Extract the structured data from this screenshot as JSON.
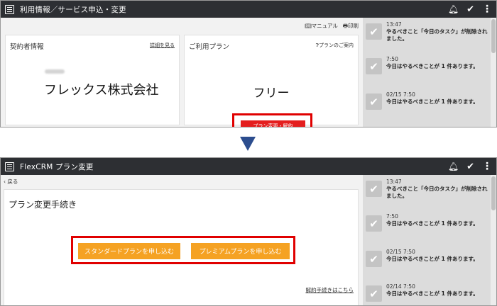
{
  "top": {
    "title": "利用情報／サービス申込・変更",
    "toolbar": {
      "manual": "マニュアル",
      "print": "印刷"
    },
    "contract_card": {
      "title": "契約者情報",
      "detail_link": "詳細を見る",
      "company": "フレックス株式会社"
    },
    "plan_card": {
      "title": "ご利用プラン",
      "help": "プランのご案内",
      "plan": "フリー",
      "change_button": "プラン変更・解約"
    },
    "notifications": [
      {
        "time": "13:47",
        "message": "やるべきこと「今日のタスク」が削除されました。"
      },
      {
        "time": "7:50",
        "message": "今日はやるべきことが 1 件あります。"
      },
      {
        "time": "02/15 7:50",
        "message": "今日はやるべきことが 1 件あります。"
      }
    ]
  },
  "bottom": {
    "title": "FlexCRM プラン変更",
    "back": "戻る",
    "page_title": "プラン変更手続き",
    "standard_button": "スタンダードプランを申し込む",
    "premium_button": "プレミアムプランを申し込む",
    "terms_link": "解約手続きはこちら",
    "notifications": [
      {
        "time": "13:47",
        "message": "やるべきこと「今日のタスク」が削除されました。"
      },
      {
        "time": "7:50",
        "message": "今日はやるべきことが 1 件あります。"
      },
      {
        "time": "02/15 7:50",
        "message": "今日はやるべきことが 1 件あります。"
      },
      {
        "time": "02/14 7:50",
        "message": "今日はやるべきことが 1 件あります。"
      }
    ]
  },
  "colors": {
    "topbar": "#2d2f33",
    "highlight": "#e00000",
    "primary_red": "#e41e1e",
    "orange": "#f5a223",
    "arrow": "#2c4d8e"
  },
  "icons": {
    "menu": "hamburger-icon",
    "bell": "bell-icon",
    "check": "check-icon",
    "more": "kebab-icon"
  }
}
